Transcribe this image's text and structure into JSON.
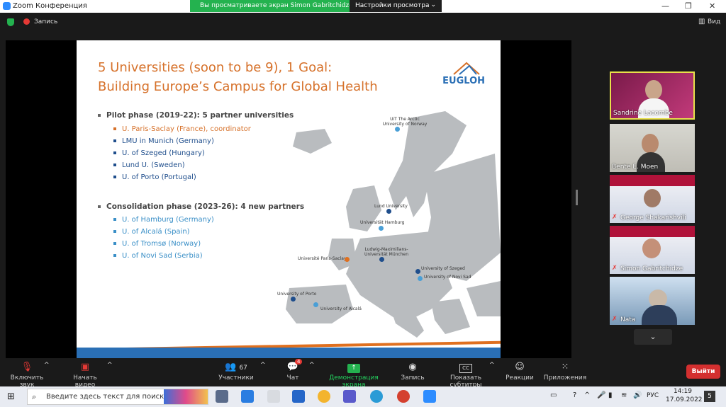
{
  "window": {
    "title": "Zoom Конференция"
  },
  "share_banner": {
    "text": "Вы просматриваете экран Simon Gabritchidze",
    "settings": "Настройки просмотра"
  },
  "top_bar": {
    "record": "Запись",
    "view": "Вид"
  },
  "slide": {
    "title_line1": "5 Universities (soon to be 9), 1 Goal:",
    "title_line2": "Building Europe’s Campus for Global Health",
    "logo": "EUGLOH",
    "pilot_heading": "Pilot phase (2019-22): 5 partner universities",
    "pilot": [
      "U. Paris-Saclay (France), coordinator",
      "LMU in Munich (Germany)",
      "U. of Szeged (Hungary)",
      "Lund U. (Sweden)",
      "U. of Porto (Portugal)"
    ],
    "consolidation_heading": "Consolidation phase (2023-26): 4 new partners",
    "consolidation": [
      "U. of Hamburg (Germany)",
      "U. of Alcalá (Spain)",
      "U. of Tromsø (Norway)",
      "U. of Novi Sad (Serbia)"
    ],
    "map_labels": {
      "tromso": "UiT The Arctic University of Norway",
      "lund": "Lund University",
      "hamburg": "Universität Hamburg",
      "lmu": "Ludwig-Maximilians-Universität München",
      "paris": "Université Paris-Saclay",
      "szeged": "University of Szeged",
      "novisad": "University of Novi Sad",
      "porto": "University of Porto",
      "alcala": "University of Alcalá"
    }
  },
  "participants": [
    {
      "name": "Sandrine Lacombe"
    },
    {
      "name": "Bente E. Moen"
    },
    {
      "name": "George Shakarishvili"
    },
    {
      "name": "Simon Gabritchidze"
    },
    {
      "name": "Nata"
    }
  ],
  "footer": {
    "mute": "Включить звук",
    "video": "Начать видео",
    "participants": "Участники",
    "participants_count": "67",
    "chat": "Чат",
    "chat_badge": "4",
    "share": "Демонстрация экрана",
    "record": "Запись",
    "subtitles": "Показать субтитры",
    "reactions": "Реакции",
    "apps": "Приложения",
    "leave": "Выйти"
  },
  "taskbar": {
    "search_placeholder": "Введите здесь текст для поиска",
    "lang": "РУС",
    "time": "14:19",
    "date": "17.09.2022",
    "notif": "5"
  },
  "colors": {
    "zoom_blue": "#2d8cff",
    "share_green": "#24b24f",
    "leave_red": "#d32f2f",
    "slide_orange": "#d6712a",
    "slide_blue": "#1f4e8c"
  }
}
